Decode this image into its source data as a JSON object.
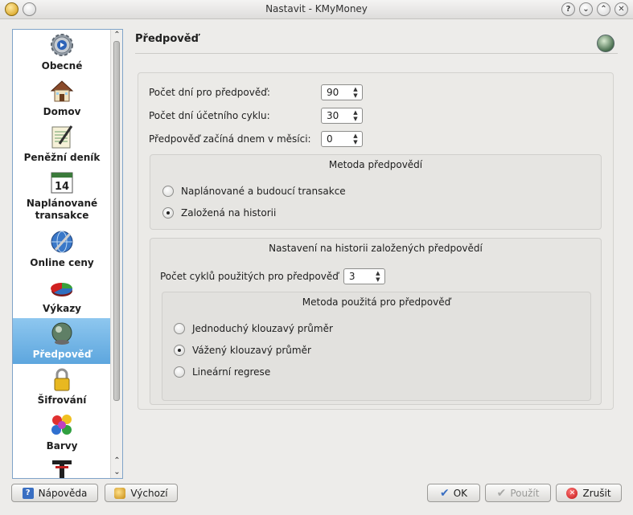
{
  "window": {
    "title": "Nastavit - KMyMoney"
  },
  "sidebar": {
    "items": [
      {
        "label": "Obecné",
        "icon": "gear-icon"
      },
      {
        "label": "Domov",
        "icon": "home-icon"
      },
      {
        "label": "Peněžní deník",
        "icon": "ledger-icon"
      },
      {
        "label": "Naplánované transakce",
        "icon": "calendar-icon"
      },
      {
        "label": "Online ceny",
        "icon": "globe-icon"
      },
      {
        "label": "Výkazy",
        "icon": "pie-chart-icon"
      },
      {
        "label": "Předpověď",
        "icon": "crystal-ball-icon",
        "selected": true
      },
      {
        "label": "Šifrování",
        "icon": "padlock-icon"
      },
      {
        "label": "Barvy",
        "icon": "palette-icon"
      },
      {
        "label": "",
        "icon": "fonts-icon"
      }
    ],
    "calendar_day": "14"
  },
  "page": {
    "title": "Předpověď",
    "icon": "crystal-ball-icon"
  },
  "form": {
    "days_label": "Počet dní pro předpověď:",
    "days_value": "90",
    "cycle_label": "Počet dní účetního cyklu:",
    "cycle_value": "30",
    "start_label": "Předpověď začíná dnem v měsíci:",
    "start_value": "0"
  },
  "method_group": {
    "title": "Metoda předpovědí",
    "options": [
      {
        "label": "Naplánované a budoucí transakce",
        "checked": false
      },
      {
        "label": "Založená na historii",
        "checked": true
      }
    ]
  },
  "history_group": {
    "title": "Nastavení na historii založených předpovědí",
    "cycles_label": "Počet cyklů použitých pro předpověď",
    "cycles_value": "3",
    "method_title": "Metoda použitá pro předpověď",
    "options": [
      {
        "label": "Jednoduchý klouzavý průměr",
        "checked": false
      },
      {
        "label": "Vážený klouzavý průměr",
        "checked": true
      },
      {
        "label": "Lineární regrese",
        "checked": false
      }
    ]
  },
  "buttons": {
    "help": "Nápověda",
    "defaults": "Výchozí",
    "ok": "OK",
    "apply": "Použít",
    "cancel": "Zrušit"
  }
}
